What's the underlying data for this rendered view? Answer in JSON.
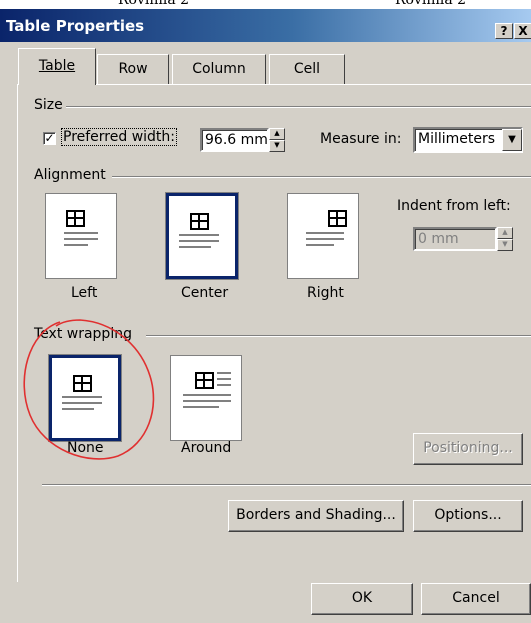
{
  "window": {
    "title": "Table Properties",
    "help_label": "?",
    "close_label": "X"
  },
  "tabs": [
    {
      "label": "Table"
    },
    {
      "label": "Row"
    },
    {
      "label": "Column"
    },
    {
      "label": "Cell"
    }
  ],
  "size": {
    "heading": "Size",
    "preferred_width_label": "Preferred width:",
    "preferred_width_checked": true,
    "preferred_width_value": "96.6 mm",
    "measure_in_label": "Measure in:",
    "measure_in_value": "Millimeters"
  },
  "alignment": {
    "heading": "Alignment",
    "options": [
      {
        "label": "Left",
        "selected": false
      },
      {
        "label": "Center",
        "selected": true
      },
      {
        "label": "Right",
        "selected": false
      }
    ],
    "indent_label": "Indent from left:",
    "indent_value": "0 mm"
  },
  "text_wrapping": {
    "heading": "Text wrapping",
    "options": [
      {
        "label": "None",
        "selected": true
      },
      {
        "label": "Around",
        "selected": false
      }
    ],
    "positioning_label": "Positioning..."
  },
  "buttons": {
    "borders_label": "Borders and Shading...",
    "options_label": "Options...",
    "ok_label": "OK",
    "cancel_label": "Cancel"
  },
  "annotation": {
    "color": "#e03030",
    "shape": "hand-drawn-ellipse"
  }
}
